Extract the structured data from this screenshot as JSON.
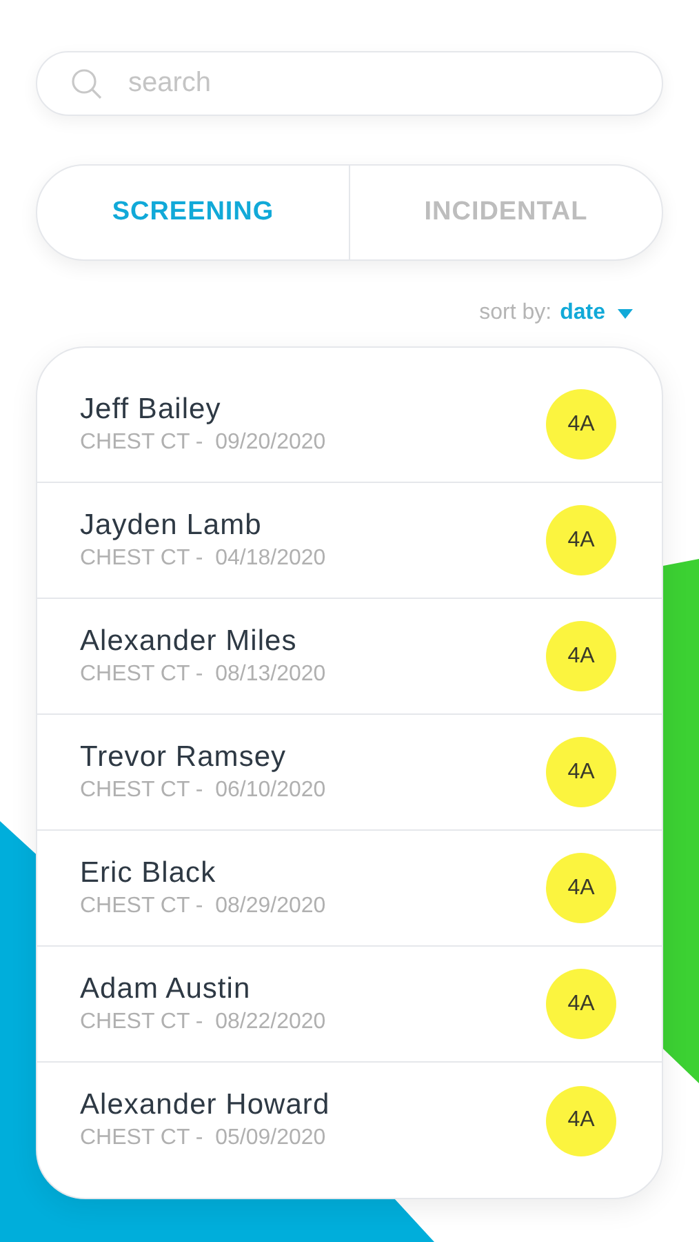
{
  "search": {
    "placeholder": "search"
  },
  "tabs": [
    {
      "label": "SCREENING",
      "selected": true
    },
    {
      "label": "INCIDENTAL",
      "selected": false
    }
  ],
  "sort": {
    "label": "sort by:",
    "value": "date"
  },
  "patients": [
    {
      "name": "Jeff Bailey",
      "detail": "CHEST CT -  09/20/2020",
      "badge": "4A"
    },
    {
      "name": "Jayden Lamb",
      "detail": "CHEST CT -  04/18/2020",
      "badge": "4A"
    },
    {
      "name": "Alexander Miles",
      "detail": "CHEST CT -  08/13/2020",
      "badge": "4A"
    },
    {
      "name": "Trevor Ramsey",
      "detail": "CHEST CT -  06/10/2020",
      "badge": "4A"
    },
    {
      "name": "Eric Black",
      "detail": "CHEST CT -  08/29/2020",
      "badge": "4A"
    },
    {
      "name": "Adam Austin",
      "detail": "CHEST CT -  08/22/2020",
      "badge": "4A"
    },
    {
      "name": "Alexander Howard",
      "detail": "CHEST CT -  05/09/2020",
      "badge": "4A"
    }
  ]
}
